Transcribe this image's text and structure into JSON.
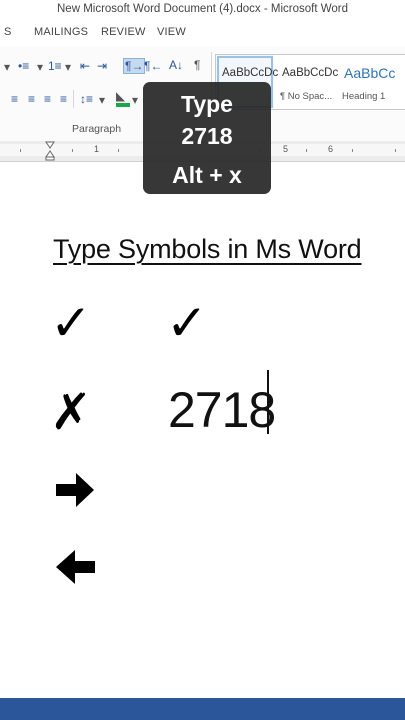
{
  "window": {
    "title": "New Microsoft Word Document (4).docx - Microsoft Word"
  },
  "tabs": [
    {
      "label": "S"
    },
    {
      "label": "MAILINGS"
    },
    {
      "label": "REVIEW"
    },
    {
      "label": "VIEW"
    }
  ],
  "ribbon": {
    "paragraph_label": "Paragraph",
    "styles": [
      {
        "sample": "AaBbCcDc",
        "name": ""
      },
      {
        "sample": "AaBbCcDc",
        "name": "¶ No Spac..."
      },
      {
        "sample": "AaBbCc",
        "name": "Heading 1"
      }
    ],
    "icons": {
      "bullets": "•≡",
      "numbering": "1≡",
      "multilevel": "≡",
      "decrease_indent": "⇤",
      "increase_indent": "⇥",
      "ltr": "¶→",
      "rtl": "¶←",
      "sort": "A↓",
      "pilcrow": "¶",
      "align_left": "≡",
      "center": "≡",
      "align_right": "≡",
      "justify": "≡",
      "line_spacing": "↕≡",
      "shading": "◣",
      "dropdown": "▾"
    }
  },
  "ruler": {
    "numbers": [
      "1",
      "5",
      "6"
    ]
  },
  "tooltip": {
    "line1": "Type",
    "line2": "2718",
    "line3": "Alt + x"
  },
  "document": {
    "title": "Type Symbols in Ms Word",
    "symbols": {
      "check_left": "✓",
      "check_right": "✓",
      "cross": "✗",
      "arrow_right": "➔",
      "arrow_left": "🡸"
    },
    "typed_text": "2718"
  },
  "colors": {
    "accent": "#2b579a",
    "tooltip_bg": "#282828",
    "heading_blue": "#2e74b5",
    "shading_green": "#18a84a"
  }
}
